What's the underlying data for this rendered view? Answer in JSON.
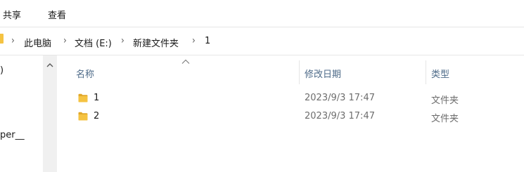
{
  "ribbon": {
    "tabs": [
      "共享",
      "查看"
    ]
  },
  "address": {
    "crumbs": [
      "此电脑",
      "文档 (E:)",
      "新建文件夹",
      "1"
    ],
    "folder_icon": "folder-icon"
  },
  "nav_pane": {
    "visible_fragments": [
      ")",
      "per__"
    ]
  },
  "columns": {
    "name": "名称",
    "modified": "修改日期",
    "type": "类型"
  },
  "files": [
    {
      "name": "1",
      "modified": "2023/9/3 17:47",
      "type": "文件夹",
      "icon": "folder-icon"
    },
    {
      "name": "2",
      "modified": "2023/9/3 17:47",
      "type": "文件夹",
      "icon": "folder-icon"
    }
  ],
  "colors": {
    "folder": "#f5c342",
    "folder_dark": "#e1a82a",
    "header_text": "#4d6a88",
    "muted_text": "#6d6d6d"
  }
}
